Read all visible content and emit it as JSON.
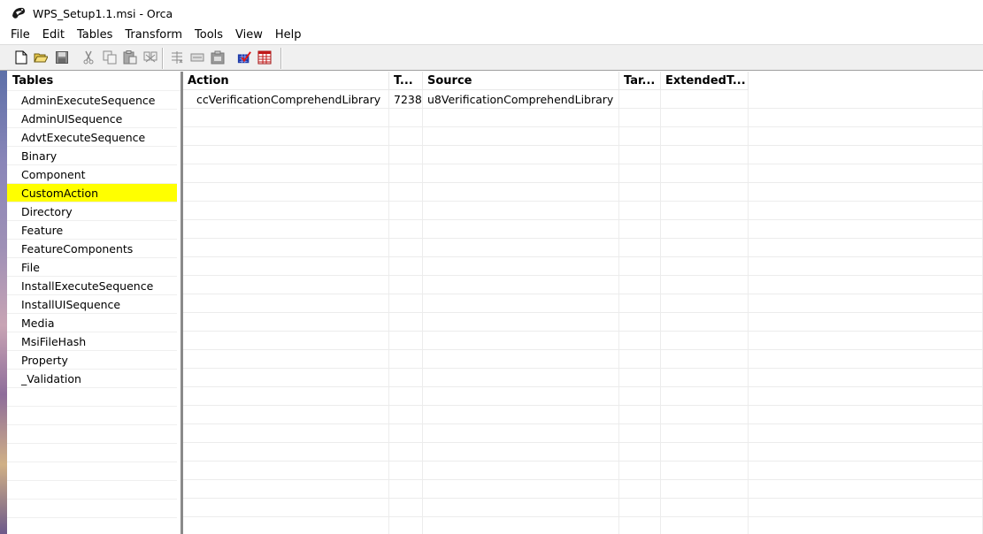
{
  "window": {
    "title": "WPS_Setup1.1.msi - Orca"
  },
  "menu": [
    "File",
    "Edit",
    "Tables",
    "Transform",
    "Tools",
    "View",
    "Help"
  ],
  "toolbar": {
    "buttons": [
      "new-icon",
      "open-icon",
      "save-icon",
      "cut-icon",
      "copy-icon",
      "paste-icon",
      "find-icon",
      "add-row-icon",
      "drop-row-icon",
      "paste-row-icon",
      "validate-icon",
      "table-icon"
    ]
  },
  "tables": {
    "header": "Tables",
    "items": [
      "AdminExecuteSequence",
      "AdminUISequence",
      "AdvtExecuteSequence",
      "Binary",
      "Component",
      "CustomAction",
      "Directory",
      "Feature",
      "FeatureComponents",
      "File",
      "InstallExecuteSequence",
      "InstallUISequence",
      "Media",
      "MsiFileHash",
      "Property",
      "_Validation"
    ],
    "selected": "CustomAction",
    "selected_color": "#ffff00"
  },
  "grid": {
    "columns": [
      "Action",
      "T...",
      "Source",
      "Tar...",
      "ExtendedT..."
    ],
    "rows": [
      [
        "ccVerificationComprehendLibrary",
        "7238",
        "u8VerificationComprehendLibrary",
        "",
        ""
      ]
    ]
  }
}
